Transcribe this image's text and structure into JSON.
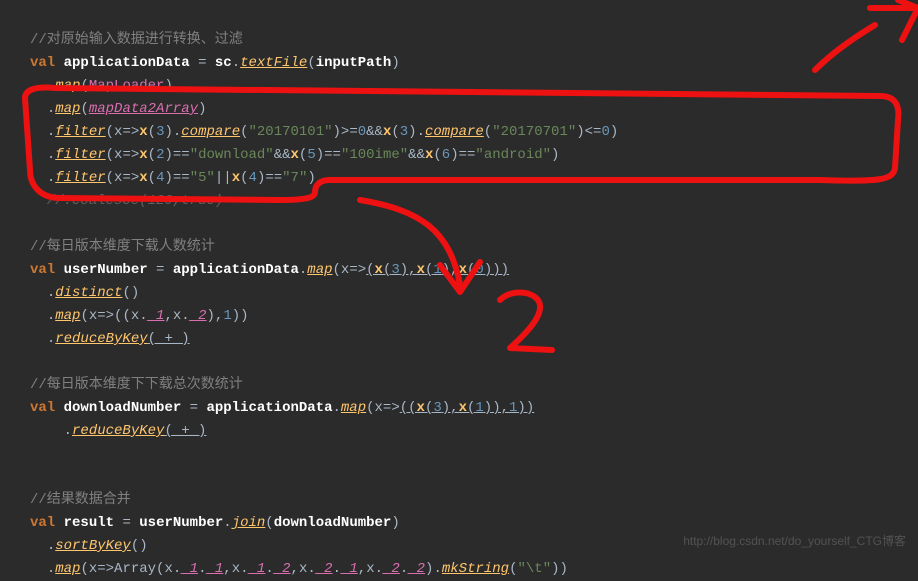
{
  "code": {
    "c1": "//对原始输入数据进行转换、过滤",
    "l2a": "val",
    "l2b": "applicationData",
    "l2c": "=",
    "l2d": "sc",
    "l2e": ".",
    "l2f": "textFile",
    "l2g": "(",
    "l2h": "inputPath",
    "l2i": ")",
    "l3a": ".",
    "l3b": "map",
    "l3c": "(",
    "l3d": "MapLoader",
    "l3e": ")",
    "l4a": ".",
    "l4b": "map",
    "l4c": "(",
    "l4d": "mapData2Array",
    "l4e": ")",
    "l5a": ".",
    "l5b": "filter",
    "l5c": "(x=>",
    "l5d": "x",
    "l5e": "(",
    "l5f": "3",
    "l5g": ").",
    "l5h": "compare",
    "l5i": "(",
    "l5j": "\"20170101\"",
    "l5k": ")>=",
    "l5l": "0",
    "l5m": "&&",
    "l5n": "x",
    "l5o": "(",
    "l5p": "3",
    "l5q": ").",
    "l5r": "compare",
    "l5s": "(",
    "l5t": "\"20170701\"",
    "l5u": ")<=",
    "l5v": "0",
    "l5w": ")",
    "l6a": ".",
    "l6b": "filter",
    "l6c": "(x=>",
    "l6d": "x",
    "l6e": "(",
    "l6f": "2",
    "l6g": ")==",
    "l6h": "\"download\"",
    "l6i": "&&",
    "l6j": "x",
    "l6k": "(",
    "l6l": "5",
    "l6m": ")==",
    "l6n": "\"100ime\"",
    "l6o": "&&",
    "l6p": "x",
    "l6q": "(",
    "l6r": "6",
    "l6s": ")==",
    "l6t": "\"android\"",
    "l6u": ")",
    "l7a": ".",
    "l7b": "filter",
    "l7c": "(x=>",
    "l7d": "x",
    "l7e": "(",
    "l7f": "4",
    "l7g": ")==",
    "l7h": "\"5\"",
    "l7i": "||",
    "l7j": "x",
    "l7k": "(",
    "l7l": "4",
    "l7m": ")==",
    "l7n": "\"7\"",
    "l7o": ")",
    "l8": "//.coalesce(120,true)",
    "c2": "//每日版本维度下载人数统计",
    "l10a": "val",
    "l10b": "userNumber",
    "l10c": "=",
    "l10d": "applicationData",
    "l10e": ".",
    "l10f": "map",
    "l10g": "(x=>",
    "l10h": "(",
    "l10i": "x",
    "l10j": "(",
    "l10k": "3",
    "l10l": "),",
    "l10m": "x",
    "l10n": "(",
    "l10o": "1",
    "l10p": "),",
    "l10q": "x",
    "l10r": "(",
    "l10s": "0",
    "l10t": ")))",
    "l11a": ".",
    "l11b": "distinct",
    "l11c": "()",
    "l12a": ".",
    "l12b": "map",
    "l12c": "(x=>((x.",
    "l12d": "_1",
    "l12e": ",x.",
    "l12f": "_2",
    "l12g": "),",
    "l12h": "1",
    "l12i": "))",
    "l13a": ".",
    "l13b": "reduceByKey",
    "l13c": "(_+_)",
    "c3": "//每日版本维度下下载总次数统计",
    "l15a": "val",
    "l15b": "downloadNumber",
    "l15c": "=",
    "l15d": "applicationData",
    "l15e": ".",
    "l15f": "map",
    "l15g": "(x=>",
    "l15h": "((",
    "l15i": "x",
    "l15j": "(",
    "l15k": "3",
    "l15l": "),",
    "l15m": "x",
    "l15n": "(",
    "l15o": "1",
    "l15p": ")),",
    "l15q": "1",
    "l15r": "))",
    "l16a": ".",
    "l16b": "reduceByKey",
    "l16c": "(_+_)",
    "c4": "//结果数据合并",
    "l18a": "val",
    "l18b": "result",
    "l18c": "=",
    "l18d": "userNumber",
    "l18e": ".",
    "l18f": "join",
    "l18g": "(",
    "l18h": "downloadNumber",
    "l18i": ")",
    "l19a": ".",
    "l19b": "sortByKey",
    "l19c": "()",
    "l20a": ".",
    "l20b": "map",
    "l20c": "(x=>Array(x.",
    "l20d": "_1",
    "l20e": ".",
    "l20f": "_1",
    "l20g": ",x.",
    "l20h": "_1",
    "l20i": ".",
    "l20j": "_2",
    "l20k": ",x.",
    "l20l": "_2",
    "l20m": ".",
    "l20n": "_1",
    "l20o": ",x.",
    "l20p": "_2",
    "l20q": ".",
    "l20r": "_2",
    "l20s": ").",
    "l20t": "mkString",
    "l20u": "(",
    "l20v": "\"\\t\"",
    "l20w": "))"
  },
  "watermark": "http://blog.csdn.net/do_yourself_CTG博客"
}
